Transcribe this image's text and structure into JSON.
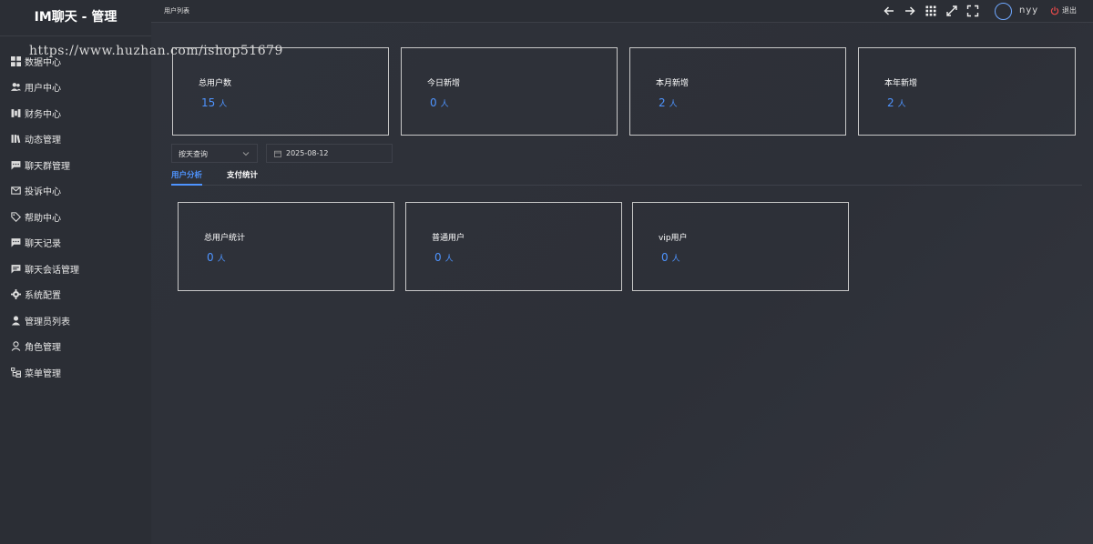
{
  "app": {
    "title": "IM聊天 - 管理",
    "watermark": "https://www.huzhan.com/ishop51679"
  },
  "sidebar": {
    "items": [
      {
        "label": "数据中心",
        "icon": "dashboard-icon"
      },
      {
        "label": "用户中心",
        "icon": "users-icon"
      },
      {
        "label": "财务中心",
        "icon": "finance-icon"
      },
      {
        "label": "动态管理",
        "icon": "library-icon"
      },
      {
        "label": "聊天群管理",
        "icon": "chat-group-icon"
      },
      {
        "label": "投诉中心",
        "icon": "mail-icon"
      },
      {
        "label": "帮助中心",
        "icon": "tag-icon"
      },
      {
        "label": "聊天记录",
        "icon": "chat-record-icon"
      },
      {
        "label": "聊天会话管理",
        "icon": "chat-session-icon"
      },
      {
        "label": "系统配置",
        "icon": "gear-icon"
      },
      {
        "label": "管理员列表",
        "icon": "admin-icon"
      },
      {
        "label": "角色管理",
        "icon": "role-icon"
      },
      {
        "label": "菜单管理",
        "icon": "menu-tree-icon"
      }
    ]
  },
  "header": {
    "breadcrumb": "用户列表",
    "username": "nyy",
    "logout_label": "退出",
    "icons": [
      "back-arrow-icon",
      "forward-arrow-icon",
      "grid-icon",
      "expand-icon",
      "fullscreen-icon"
    ]
  },
  "summary_cards": [
    {
      "label": "总用户数",
      "value": "15",
      "unit": "人"
    },
    {
      "label": "今日新增",
      "value": "0",
      "unit": "人"
    },
    {
      "label": "本月新增",
      "value": "2",
      "unit": "人"
    },
    {
      "label": "本年新增",
      "value": "2",
      "unit": "人"
    }
  ],
  "filters": {
    "mode_selected": "按天查询",
    "date_value": "2025-08-12"
  },
  "tabs": [
    {
      "label": "用户分析",
      "active": true
    },
    {
      "label": "支付统计",
      "active": false
    }
  ],
  "analysis_cards": [
    {
      "label": "总用户统计",
      "value": "0",
      "unit": "人"
    },
    {
      "label": "普通用户",
      "value": "0",
      "unit": "人"
    },
    {
      "label": "vip用户",
      "value": "0",
      "unit": "人"
    }
  ],
  "colors": {
    "accent": "#4e94ff",
    "sidebar_bg": "#2b2e35",
    "main_bg": "#2d3038",
    "logout_icon": "#e84a4a"
  }
}
